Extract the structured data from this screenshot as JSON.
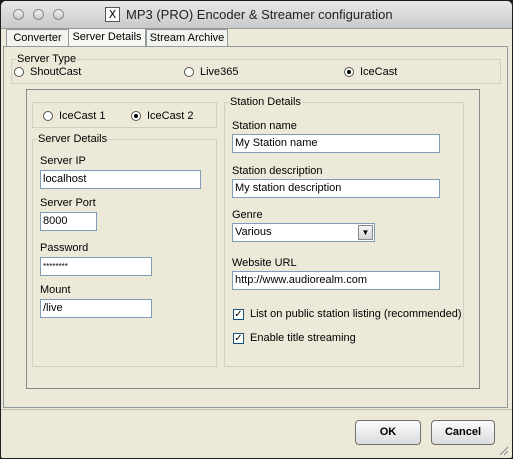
{
  "window": {
    "title": "MP3 (PRO) Encoder & Streamer configuration",
    "app_icon_glyph": "X"
  },
  "tabs": [
    {
      "label": "Converter",
      "active": false
    },
    {
      "label": "Server Details",
      "active": true
    },
    {
      "label": "Stream Archive",
      "active": false
    }
  ],
  "server_type": {
    "legend": "Server Type",
    "options": [
      {
        "label": "ShoutCast",
        "selected": false
      },
      {
        "label": "Live365",
        "selected": false
      },
      {
        "label": "IceCast",
        "selected": true
      }
    ]
  },
  "icecast_version": {
    "options": [
      {
        "label": "IceCast 1",
        "selected": false
      },
      {
        "label": "IceCast 2",
        "selected": true
      }
    ]
  },
  "server_details": {
    "legend": "Server Details",
    "ip_label": "Server IP",
    "ip_value": "localhost",
    "port_label": "Server Port",
    "port_value": "8000",
    "password_label": "Password",
    "password_value": "********",
    "mount_label": "Mount",
    "mount_value": "/live"
  },
  "station_details": {
    "legend": "Station Details",
    "name_label": "Station name",
    "name_value": "My Station name",
    "description_label": "Station description",
    "description_value": "My station description",
    "genre_label": "Genre",
    "genre_value": "Various",
    "website_label": "Website URL",
    "website_value": "http://www.audiorealm.com",
    "list_public_label": "List on public station listing (recommended)",
    "list_public_checked": true,
    "title_streaming_label": "Enable title streaming",
    "title_streaming_checked": true
  },
  "buttons": {
    "ok": "OK",
    "cancel": "Cancel"
  }
}
